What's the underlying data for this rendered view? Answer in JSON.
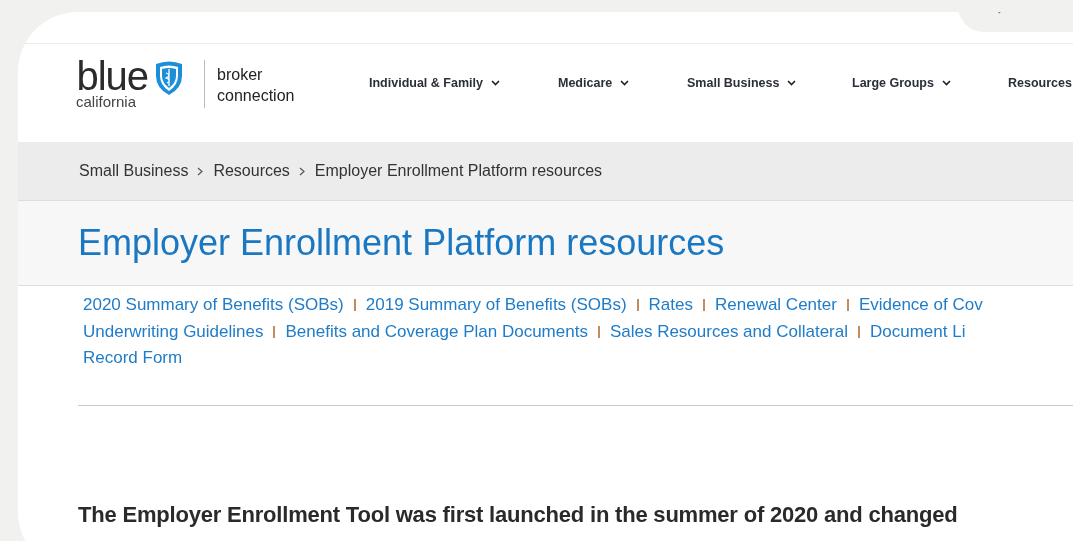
{
  "logo": {
    "wordmark": "blue",
    "region": "california",
    "product": "broker connection"
  },
  "nav": [
    {
      "label": "Individual & Family",
      "dropdown": true
    },
    {
      "label": "Medicare",
      "dropdown": true
    },
    {
      "label": "Small Business",
      "dropdown": true
    },
    {
      "label": "Large Groups",
      "dropdown": true
    },
    {
      "label": "Resources"
    }
  ],
  "breadcrumb": [
    "Small Business",
    "Resources",
    "Employer Enrollment Platform resources"
  ],
  "title": "Employer Enrollment Platform resources",
  "link_rows": [
    [
      "2020 Summary of Benefits (SOBs)",
      "2019 Summary of Benefits (SOBs)",
      "Rates",
      "Renewal Center",
      "Evidence of Cov"
    ],
    [
      "Underwriting Guidelines",
      "Benefits and Coverage Plan Documents",
      "Sales Resources and Collateral",
      "Document Li"
    ],
    [
      "Record Form"
    ]
  ],
  "intro": "The Employer Enrollment Tool was first launched in the summer of 2020 and changed"
}
